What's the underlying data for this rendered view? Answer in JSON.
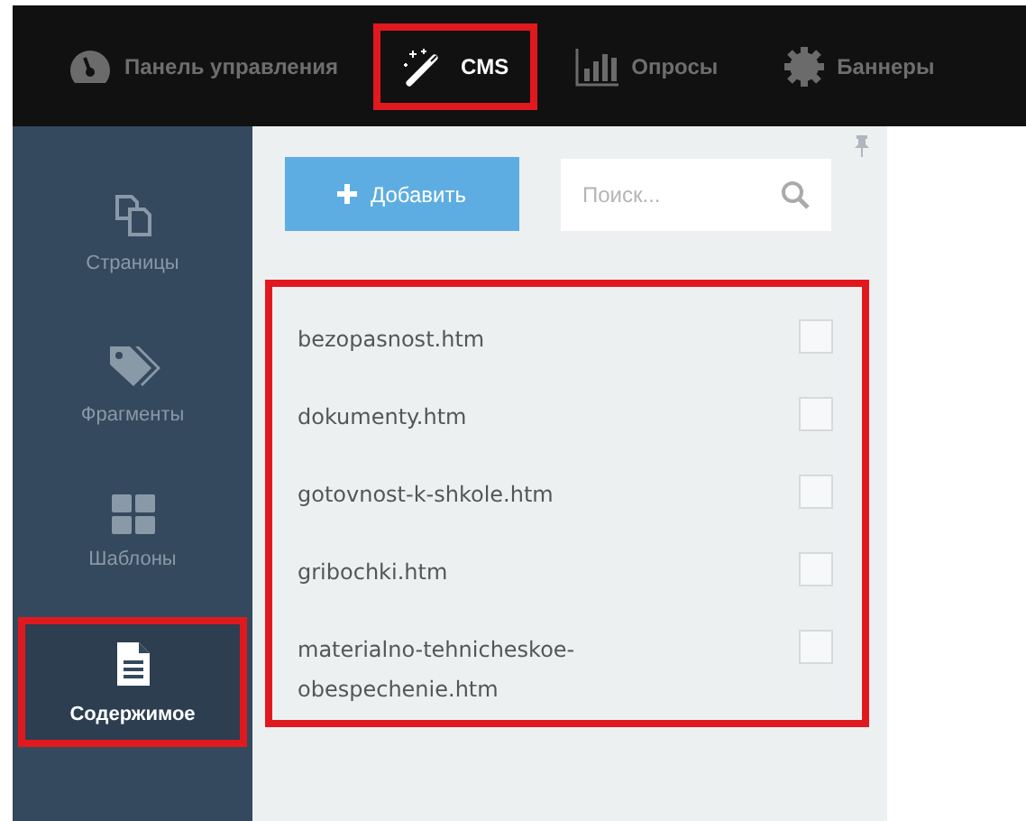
{
  "top_nav": [
    {
      "label": "Панель управления",
      "kind": "gauge",
      "selected": false,
      "highlighted": false
    },
    {
      "label": "CMS",
      "kind": "wand",
      "selected": true,
      "highlighted": true
    },
    {
      "label": "Опросы",
      "kind": "chart",
      "selected": false,
      "highlighted": false
    },
    {
      "label": "Баннеры",
      "kind": "gear",
      "selected": false,
      "highlighted": false
    }
  ],
  "sidebar": {
    "items": [
      {
        "label": "Страницы",
        "kind": "pages",
        "selected": false,
        "highlighted": false
      },
      {
        "label": "Фрагменты",
        "kind": "tags",
        "selected": false,
        "highlighted": false
      },
      {
        "label": "Шаблоны",
        "kind": "grid",
        "selected": false,
        "highlighted": false
      },
      {
        "label": "Содержимое",
        "kind": "doc",
        "selected": true,
        "highlighted": true
      }
    ]
  },
  "panel": {
    "add_button": "Добавить",
    "search": {
      "placeholder": "Поиск..."
    },
    "list": {
      "highlighted": true,
      "items": [
        {
          "name": "bezopasnost.htm",
          "checked": false
        },
        {
          "name": "dokumenty.htm",
          "checked": false
        },
        {
          "name": "gotovnost-k-shkole.htm",
          "checked": false
        },
        {
          "name": "gribochki.htm",
          "checked": false
        },
        {
          "name": "materialno-tehnicheskoe-obespechenie.htm",
          "checked": false
        }
      ]
    }
  }
}
